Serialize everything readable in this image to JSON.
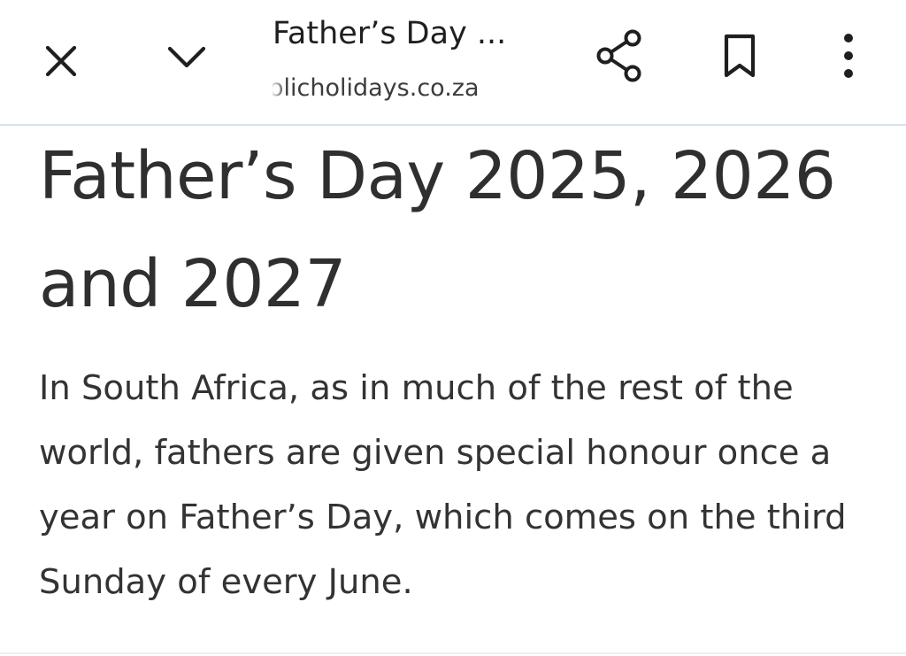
{
  "toolbar": {
    "close_icon": "close-icon",
    "chevron_icon": "chevron-down-icon",
    "tab_title": "Father’s Day ...",
    "tab_url": "olicholidays.co.za",
    "share_icon": "share-icon",
    "bookmark_icon": "bookmark-icon",
    "menu_icon": "more-vertical-icon"
  },
  "article": {
    "headline": "Father’s Day 2025, 2026 and 2027",
    "body": "In South Africa, as in much of the rest of the world, fathers are given special honour once a year on Father’s Day, which comes on the third Sunday of every June."
  },
  "colors": {
    "text": "#2f2f2f",
    "divider": "#d6e1ec",
    "background": "#ffffff"
  }
}
